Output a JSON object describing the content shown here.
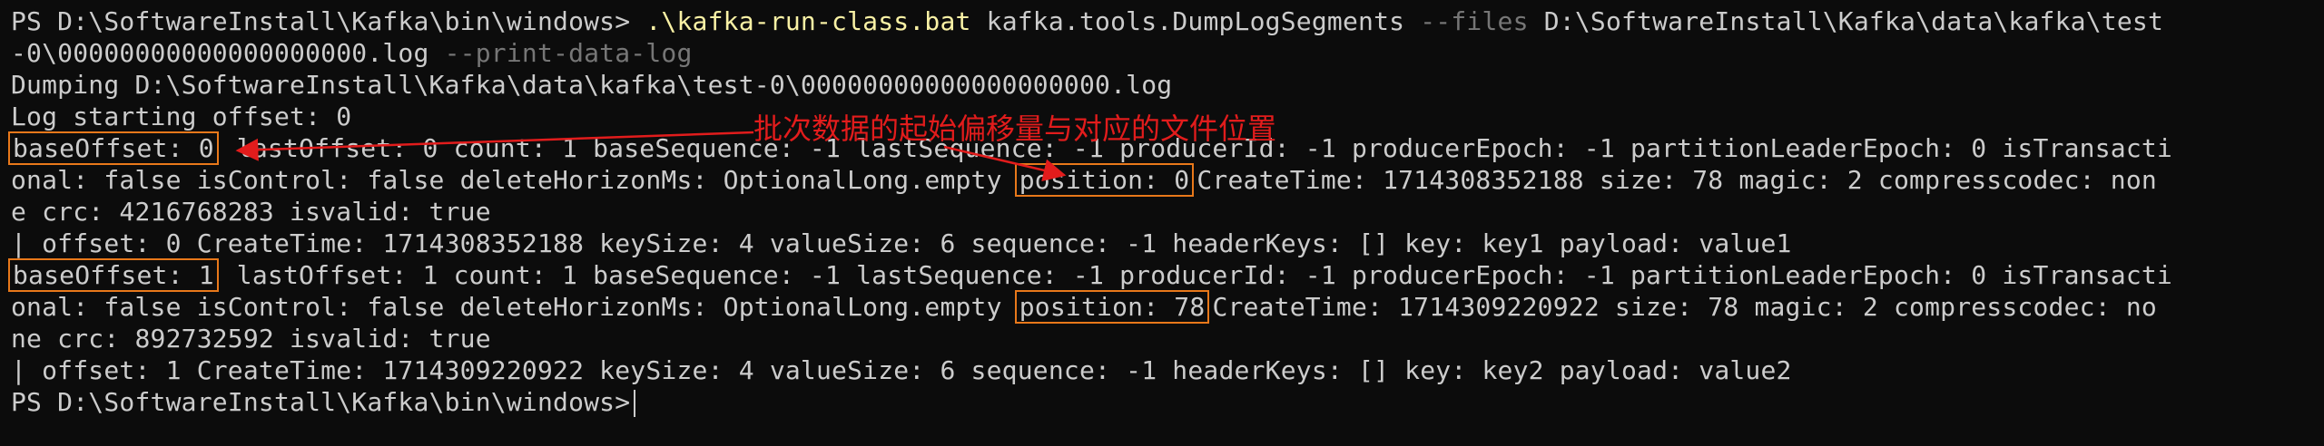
{
  "terminal": {
    "prompt1": "PS D:\\SoftwareInstall\\Kafka\\bin\\windows> ",
    "exe": ".\\kafka-run-class.bat",
    "class_arg": " kafka.tools.DumpLogSegments ",
    "files_flag": "--files",
    "files_path_part1": " D:\\SoftwareInstall\\Kafka\\data\\kafka\\test",
    "files_path_part2": "-0\\00000000000000000000.log ",
    "print_flag": "--print-data-log",
    "dumping": "Dumping D:\\SoftwareInstall\\Kafka\\data\\kafka\\test-0\\00000000000000000000.log",
    "log_start": "Log starting offset: 0",
    "batch1": {
      "base_offset": "baseOffset: 0",
      "line1_rest": " lastOffset: 0 count: 1 baseSequence: -1 lastSequence: -1 producerId: -1 producerEpoch: -1 partitionLeaderEpoch: 0 isTransacti",
      "line2_pre": "onal: false isControl: false deleteHorizonMs: OptionalLong.empty ",
      "position": "position: 0",
      "line2_post": "CreateTime: 1714308352188 size: 78 magic: 2 compresscodec: non",
      "line3": "e crc: 4216768283 isvalid: true",
      "record": "| offset: 0 CreateTime: 1714308352188 keySize: 4 valueSize: 6 sequence: -1 headerKeys: [] key: key1 payload: value1"
    },
    "batch2": {
      "base_offset": "baseOffset: 1",
      "line1_rest": " lastOffset: 1 count: 1 baseSequence: -1 lastSequence: -1 producerId: -1 producerEpoch: -1 partitionLeaderEpoch: 0 isTransacti",
      "line2_pre": "onal: false isControl: false deleteHorizonMs: OptionalLong.empty ",
      "position": "position: 78",
      "line2_post": "CreateTime: 1714309220922 size: 78 magic: 2 compresscodec: no",
      "line3": "ne crc: 892732592 isvalid: true",
      "record": "| offset: 1 CreateTime: 1714309220922 keySize: 4 valueSize: 6 sequence: -1 headerKeys: [] key: key2 payload: value2"
    },
    "prompt2": "PS D:\\SoftwareInstall\\Kafka\\bin\\windows>"
  },
  "annotation": {
    "text": "批次数据的起始偏移量与对应的文件位置"
  },
  "colors": {
    "background": "#0c0c0c",
    "text": "#cccccc",
    "exe": "#f9f1a5",
    "flag": "#767676",
    "highlight_box": "#e8781a",
    "annotation": "#e21c1c"
  }
}
